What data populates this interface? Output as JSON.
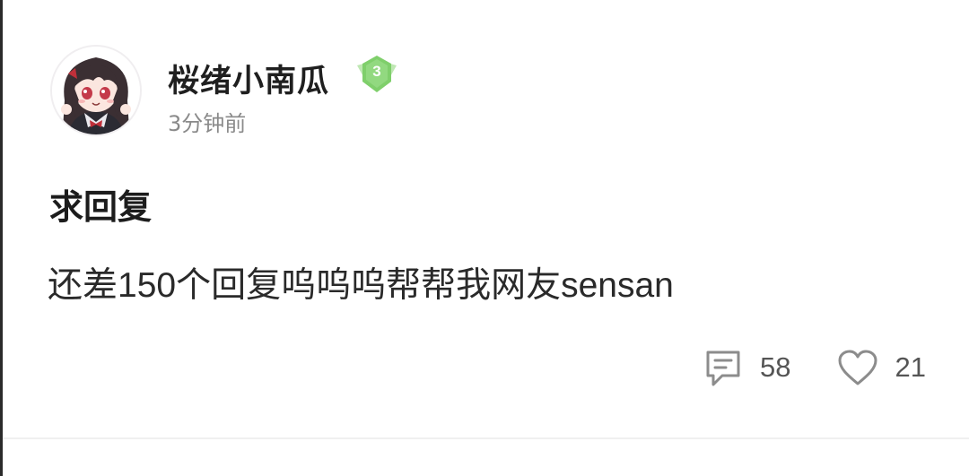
{
  "author": {
    "name": "桜绪小南瓜",
    "level": "3",
    "time": "3分钟前"
  },
  "post": {
    "title": "求回复",
    "body": "还差150个回复呜呜呜帮帮我网友sensan"
  },
  "stats": {
    "comments": "58",
    "likes": "21"
  },
  "icons": {
    "comment": "comment-icon",
    "like": "heart-icon",
    "level": "level-badge-icon"
  },
  "colors": {
    "badge_green": "#7fcf6b",
    "text_primary": "#1f1f1f",
    "text_secondary": "#8a8a8a"
  }
}
